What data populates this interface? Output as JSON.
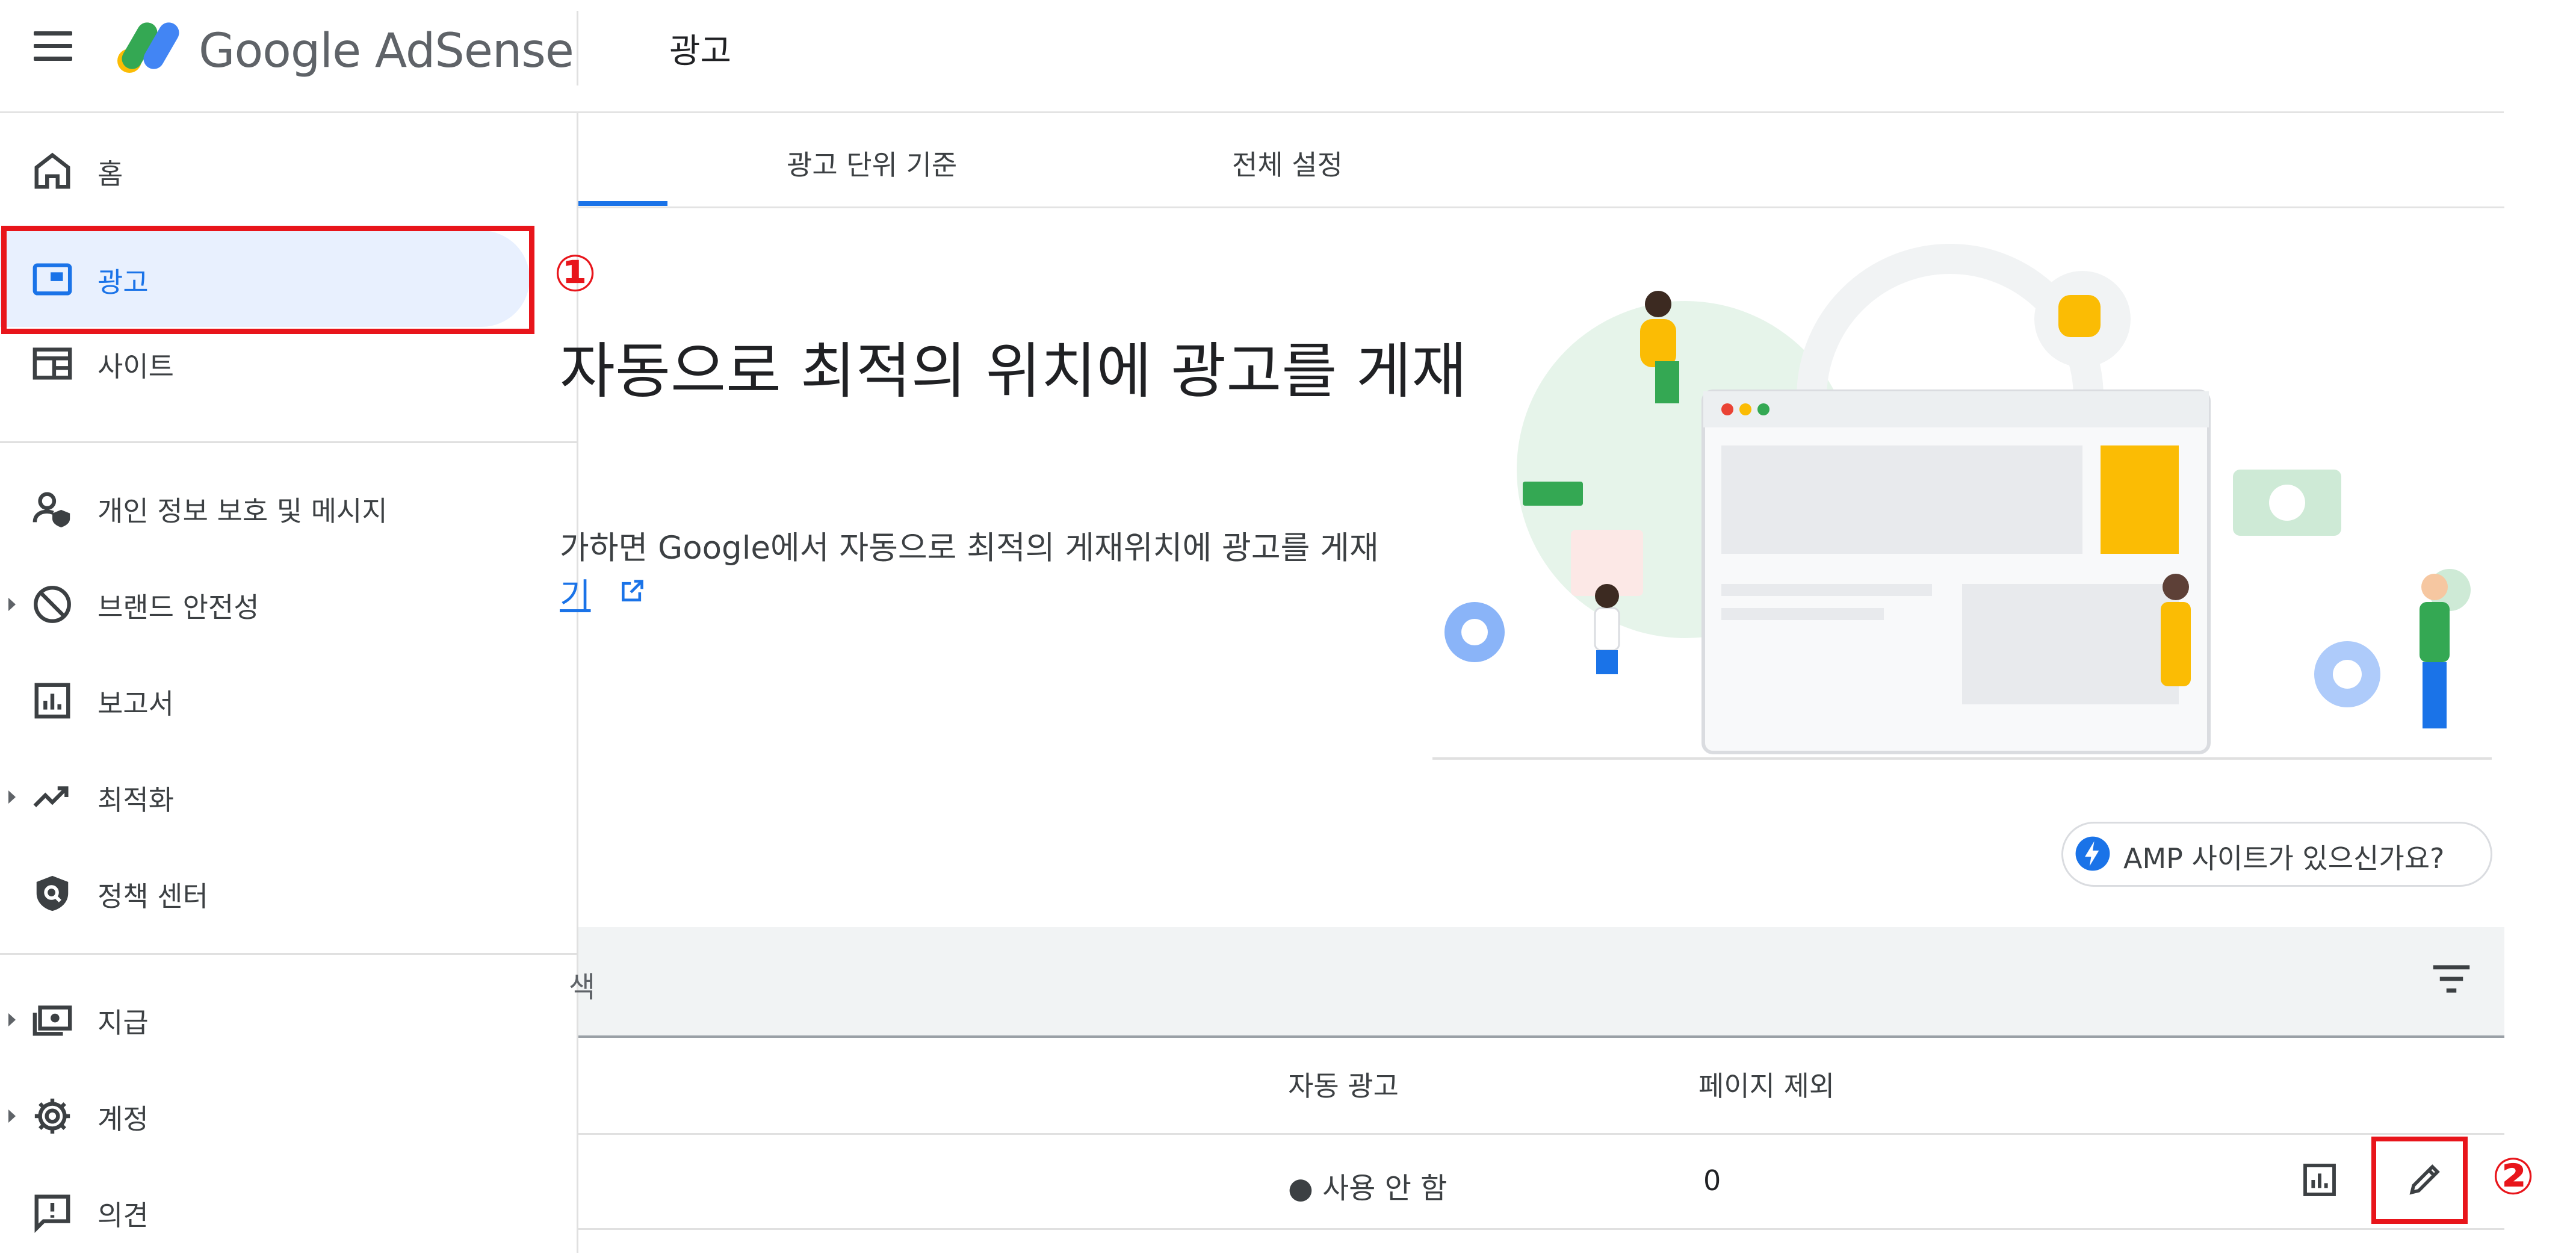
{
  "header": {
    "brand": "Google AdSense",
    "title": "광고"
  },
  "sidebar": {
    "items": [
      {
        "label": "홈",
        "icon": "home-icon"
      },
      {
        "label": "광고",
        "icon": "ads-icon",
        "selected": true
      },
      {
        "label": "사이트",
        "icon": "sites-icon"
      },
      {
        "label": "개인 정보 보호 및 메시지",
        "icon": "privacy-icon"
      },
      {
        "label": "브랜드 안전성",
        "icon": "block-icon",
        "expandable": true
      },
      {
        "label": "보고서",
        "icon": "report-icon"
      },
      {
        "label": "최적화",
        "icon": "trending-icon",
        "expandable": true
      },
      {
        "label": "정책 센터",
        "icon": "policy-shield-icon"
      },
      {
        "label": "지급",
        "icon": "payments-icon",
        "expandable": true
      },
      {
        "label": "계정",
        "icon": "gear-icon",
        "expandable": true
      },
      {
        "label": "의견",
        "icon": "feedback-icon"
      }
    ]
  },
  "tabs": [
    {
      "label": "광고 단위 기준"
    },
    {
      "label": "전체 설정"
    }
  ],
  "hero": {
    "title": "자동으로 최적의 위치에 광고를 게재",
    "description": "가하면 Google에서 자동으로 최적의 게재위치에 광고를 게재",
    "link": "기"
  },
  "amp_chip": {
    "label": "AMP 사이트가 있으신가요?"
  },
  "table": {
    "search_fragment": "색",
    "columns": {
      "auto_ads": "자동 광고",
      "page_exclusion": "페이지 제외"
    },
    "row": {
      "status": "● 사용 안 함",
      "exclusions": "0"
    }
  },
  "annotations": {
    "step1": "①",
    "step2": "②"
  },
  "colors": {
    "accent": "#1a73e8",
    "highlight": "#e8151b",
    "selected_bg": "#e8f0fe"
  }
}
